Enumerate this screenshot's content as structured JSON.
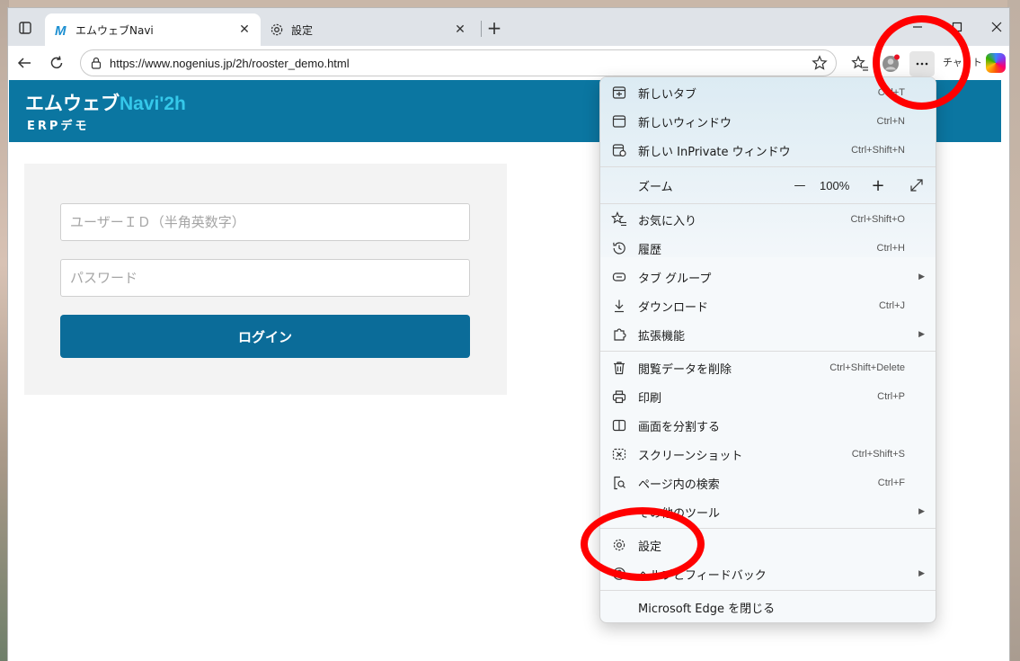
{
  "browser": {
    "tabs": [
      {
        "title": "エムウェブNavi",
        "favicon": "M"
      },
      {
        "title": "設定"
      }
    ],
    "url": "https://www.nogenius.jp/2h/rooster_demo.html",
    "chat_label": "チャット",
    "close_symbol": "✕",
    "new_tab_symbol": "+"
  },
  "site": {
    "brand_part1": "エムウェブ",
    "brand_part2": "Navi'2h",
    "subtitle": "ERPデモ",
    "user_placeholder": "ユーザーＩＤ（半角英数字）",
    "password_placeholder": "パスワード",
    "login_label": "ログイン"
  },
  "menu": {
    "items": [
      {
        "label": "新しいタブ",
        "shortcut": "Ctrl+T"
      },
      {
        "label": "新しいウィンドウ",
        "shortcut": "Ctrl+N"
      },
      {
        "label": "新しい InPrivate ウィンドウ",
        "shortcut": "Ctrl+Shift+N"
      },
      {
        "label": "ズーム"
      },
      {
        "label": "お気に入り",
        "shortcut": "Ctrl+Shift+O"
      },
      {
        "label": "履歴",
        "shortcut": "Ctrl+H"
      },
      {
        "label": "タブ グループ"
      },
      {
        "label": "ダウンロード",
        "shortcut": "Ctrl+J"
      },
      {
        "label": "拡張機能"
      },
      {
        "label": "閲覧データを削除",
        "shortcut": "Ctrl+Shift+Delete"
      },
      {
        "label": "印刷",
        "shortcut": "Ctrl+P"
      },
      {
        "label": "画面を分割する"
      },
      {
        "label": "スクリーンショット",
        "shortcut": "Ctrl+Shift+S"
      },
      {
        "label": "ページ内の検索",
        "shortcut": "Ctrl+F"
      },
      {
        "label": "その他のツール"
      },
      {
        "label": "設定"
      },
      {
        "label": "ヘルプとフィードバック"
      },
      {
        "label": "Microsoft Edge を閉じる"
      }
    ],
    "zoom": {
      "value": "100%",
      "minus": "—",
      "plus": "+"
    }
  },
  "colors": {
    "header": "#0b76a1",
    "brand_accent": "#35c8ea",
    "button": "#0b6c99",
    "annotation": "#ff0000"
  }
}
